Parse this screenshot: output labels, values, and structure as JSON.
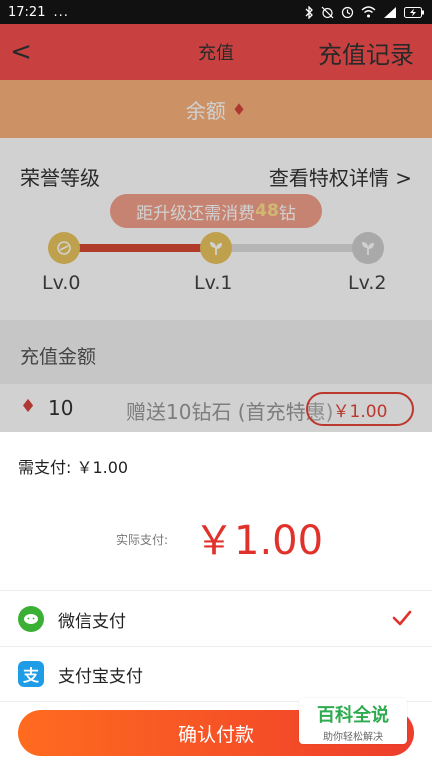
{
  "status_bar": {
    "time": "17:21",
    "dots": "...",
    "icons": [
      "bluetooth-icon",
      "alarm-off-icon",
      "clock-icon",
      "wifi-icon",
      "signal-icon",
      "battery-charging-icon"
    ]
  },
  "header": {
    "back": "<",
    "title": "充值",
    "records_link": "充值记录"
  },
  "balance": {
    "label": "余额",
    "gem_icon": "diamond-icon"
  },
  "honor": {
    "title": "荣誉等级",
    "detail_link": "查看特权详情",
    "detail_chevron": ">",
    "upgrade_prefix": "距升级还需消费",
    "upgrade_amount": "48",
    "upgrade_suffix": "钻",
    "current_level_index": 1,
    "levels": [
      {
        "label": "Lv.0",
        "icon": "slash-circle-icon"
      },
      {
        "label": "Lv.1",
        "icon": "sprout-icon"
      },
      {
        "label": "Lv.2",
        "icon": "sprout-icon"
      }
    ]
  },
  "recharge": {
    "section_title": "充值金额",
    "options": [
      {
        "diamonds": "10",
        "bonus": "赠送10钻石 (首充特惠)",
        "price": "￥1.00"
      }
    ]
  },
  "payment_sheet": {
    "need_pay": "需支付: ￥1.00",
    "actual_label": "实际支付:",
    "actual_amount": "￥1.00",
    "methods": [
      {
        "name": "微信支付",
        "icon": "wechat-icon",
        "selected": true
      },
      {
        "name": "支付宝支付",
        "icon": "alipay-icon",
        "alipay_glyph": "支",
        "selected": false
      }
    ],
    "confirm_label": "确认付款"
  },
  "watermark": {
    "title": "百科全说",
    "subtitle": "助你轻松解决"
  },
  "colors": {
    "header_red": "#f5504f",
    "balance_orange": "#f9b17c",
    "accent_red": "#e0322b",
    "wechat_green": "#3cb034",
    "alipay_blue": "#1e9de6",
    "button_start": "#ff6b1f",
    "button_end": "#ee3d2c"
  }
}
